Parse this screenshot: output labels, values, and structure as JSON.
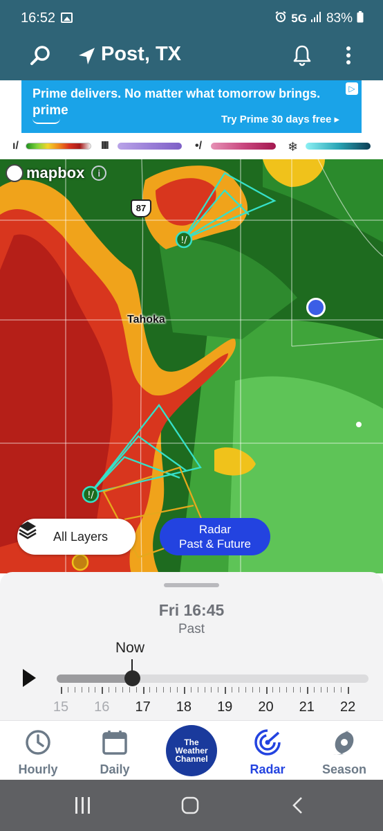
{
  "status_bar": {
    "time": "16:52",
    "network": "5G",
    "battery": "83%"
  },
  "header": {
    "location": "Post, TX"
  },
  "ad": {
    "headline": "Prime delivers. No matter what tomorrow brings.",
    "brand": "prime",
    "cta": "Try Prime 30 days free ▸"
  },
  "legend": {
    "items": [
      {
        "icon": "rain-icon",
        "gradient": "linear-gradient(90deg,#1f8f1f,#7fd33a,#f2d52a,#f08a1b,#d8321e,#a51a1a,#f4f4f4)"
      },
      {
        "icon": "mix-icon",
        "gradient": "linear-gradient(90deg,#b9a4e8,#9a7fd8,#7d5fc6)"
      },
      {
        "icon": "sleet-icon",
        "gradient": "linear-gradient(90deg,#e691b5,#c9487f,#a3174f)"
      },
      {
        "icon": "snow-icon",
        "gradient": "linear-gradient(90deg,#8cf0f4,#2aa6b6,#0d3e55)"
      }
    ]
  },
  "map": {
    "attribution": "mapbox",
    "highway_shield": "87",
    "city_label": "Tahoka",
    "buttons": {
      "layers": "All Layers",
      "radar": "Radar\nPast & Future"
    }
  },
  "timeline": {
    "time": "Fri 16:45",
    "mode": "Past",
    "now_label": "Now",
    "hours": [
      {
        "label": "15",
        "past": true
      },
      {
        "label": "16",
        "past": true
      },
      {
        "label": "17",
        "past": false
      },
      {
        "label": "18",
        "past": false
      },
      {
        "label": "19",
        "past": false
      },
      {
        "label": "20",
        "past": false
      },
      {
        "label": "21",
        "past": false
      },
      {
        "label": "22",
        "past": false
      }
    ]
  },
  "tabs": [
    {
      "label": "Hourly",
      "icon": "clock-icon",
      "active": false
    },
    {
      "label": "Daily",
      "icon": "calendar-icon",
      "active": false
    },
    {
      "label": "Radar",
      "icon": "radar-icon",
      "active": true
    },
    {
      "label": "Season",
      "icon": "hurricane-icon",
      "active": false
    }
  ],
  "twc_logo": {
    "line1": "The",
    "line2": "Weather",
    "line3": "Channel"
  }
}
